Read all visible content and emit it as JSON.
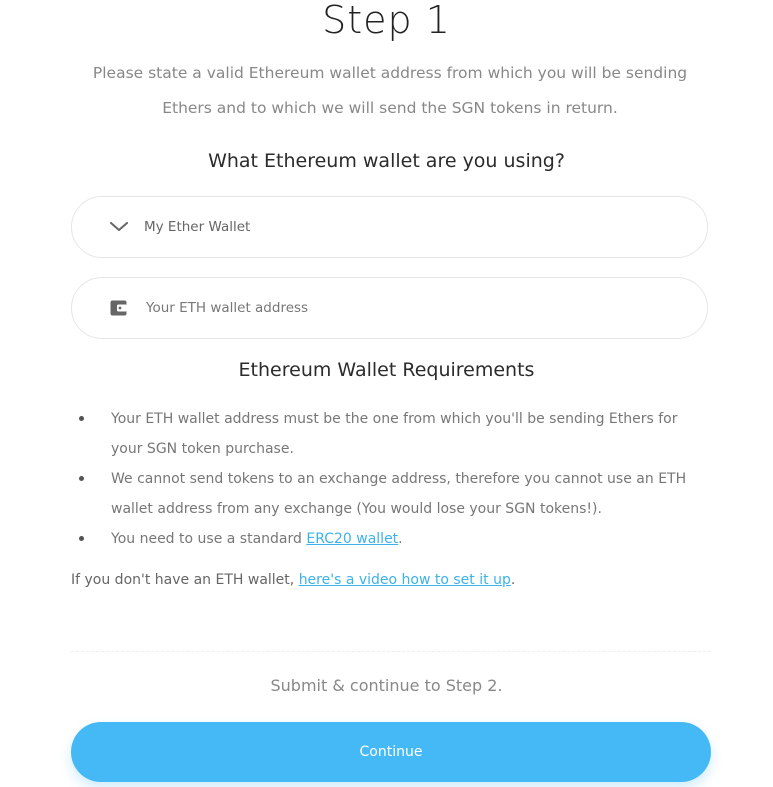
{
  "step": {
    "title": "Step 1"
  },
  "intro": {
    "text": "Please state a valid Ethereum wallet address from which you will be sending Ethers and to which we will send the SGN tokens in return."
  },
  "wallet_question": "What Ethereum wallet are you using?",
  "wallet_select": {
    "selected": "My Ether Wallet",
    "icon": "chevron-down-icon"
  },
  "address_field": {
    "placeholder": "Your ETH wallet address",
    "value": "",
    "icon": "wallet-icon"
  },
  "requirements": {
    "title": "Ethereum Wallet Requirements",
    "items": [
      {
        "text": "Your ETH wallet address must be the one from which you'll be sending Ethers for your SGN token purchase."
      },
      {
        "text": "We cannot send tokens to an exchange address, therefore you cannot use an ETH wallet address from any exchange (You would lose your SGN tokens!)."
      },
      {
        "text_before": "You need to use a standard ",
        "link": "ERC20 wallet",
        "text_after": "."
      }
    ]
  },
  "no_wallet": {
    "text_before": "If you don't have an ETH wallet, ",
    "link": "here's a video how to set it up",
    "text_after": "."
  },
  "submit_note": "Submit & continue to Step 2.",
  "continue_button": {
    "label": "Continue"
  },
  "colors": {
    "accent": "#45b9f5",
    "link": "#3bb2e8",
    "muted_text": "#888888"
  }
}
